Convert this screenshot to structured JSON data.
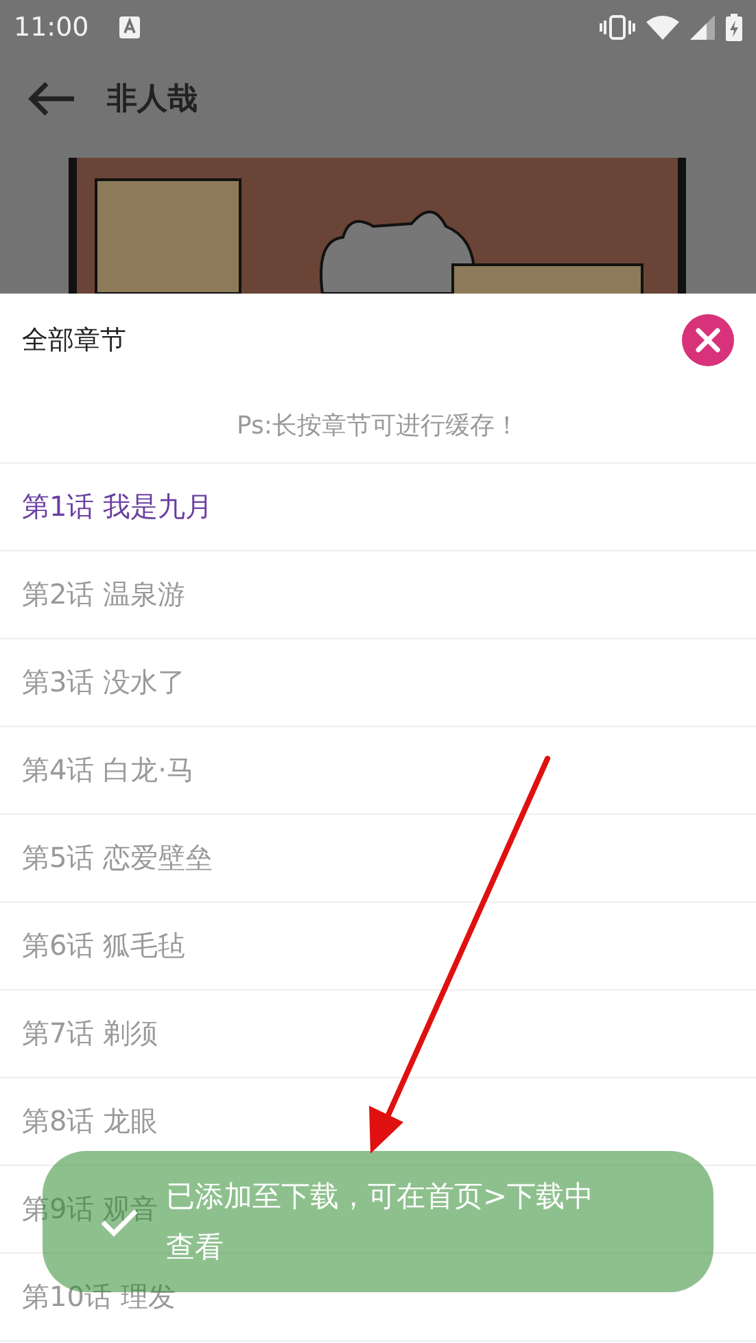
{
  "status_bar": {
    "time": "11:00"
  },
  "app_bar": {
    "title": "非人哉"
  },
  "chapter_sheet": {
    "title": "全部章节",
    "hint": "Ps:长按章节可进行缓存！",
    "chapters": [
      {
        "label": "第1话 我是九月",
        "selected": true
      },
      {
        "label": "第2话 温泉游",
        "selected": false
      },
      {
        "label": "第3话 没水了",
        "selected": false
      },
      {
        "label": "第4话 白龙·马",
        "selected": false
      },
      {
        "label": "第5话 恋爱壁垒",
        "selected": false
      },
      {
        "label": "第6话 狐毛毡",
        "selected": false
      },
      {
        "label": "第7话 剃须",
        "selected": false
      },
      {
        "label": "第8话 龙眼",
        "selected": false
      },
      {
        "label": "第9话 观音",
        "selected": false
      },
      {
        "label": "第10话 理发",
        "selected": false
      }
    ]
  },
  "toast": {
    "message": "已添加至下载，可在首页>下载中查看"
  }
}
